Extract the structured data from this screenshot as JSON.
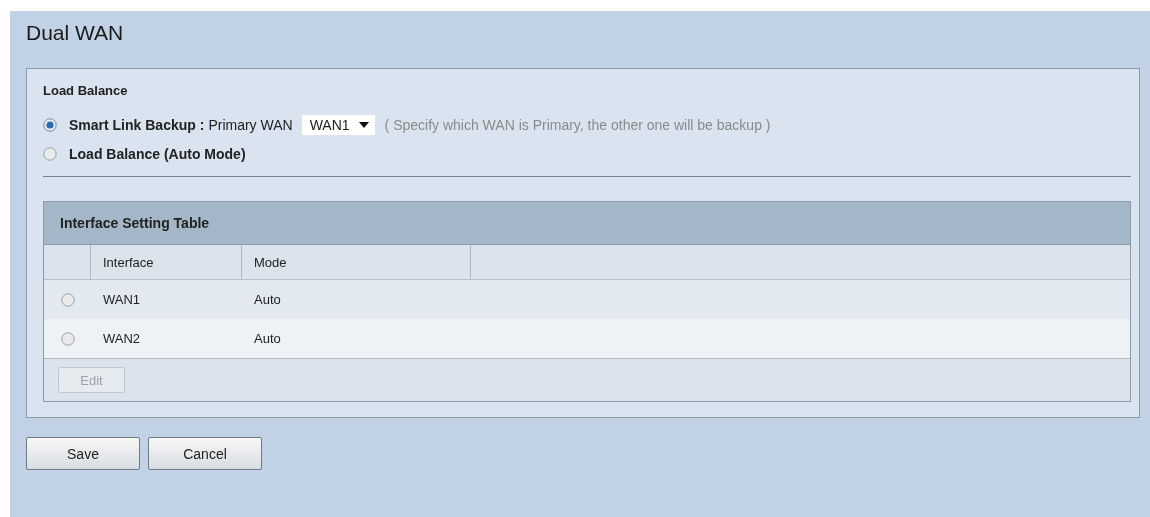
{
  "page": {
    "title": "Dual WAN"
  },
  "load_balance": {
    "heading": "Load Balance",
    "options": [
      {
        "kind": "smart",
        "label": "Smart Link Backup :",
        "selected": true,
        "field_label": "Primary WAN",
        "dropdown_value": "WAN1",
        "hint": "( Specify which WAN is Primary, the other one will be backup )"
      },
      {
        "kind": "plain",
        "label": "Load Balance (Auto Mode)",
        "selected": false
      }
    ]
  },
  "table": {
    "title": "Interface Setting Table",
    "columns": [
      "Interface",
      "Mode"
    ],
    "rows": [
      {
        "selected": false,
        "cells": [
          "WAN1",
          "Auto"
        ]
      },
      {
        "selected": false,
        "cells": [
          "WAN2",
          "Auto"
        ]
      }
    ],
    "edit_button": {
      "label": "Edit",
      "disabled": true
    }
  },
  "buttons": [
    "Save",
    "Cancel"
  ]
}
